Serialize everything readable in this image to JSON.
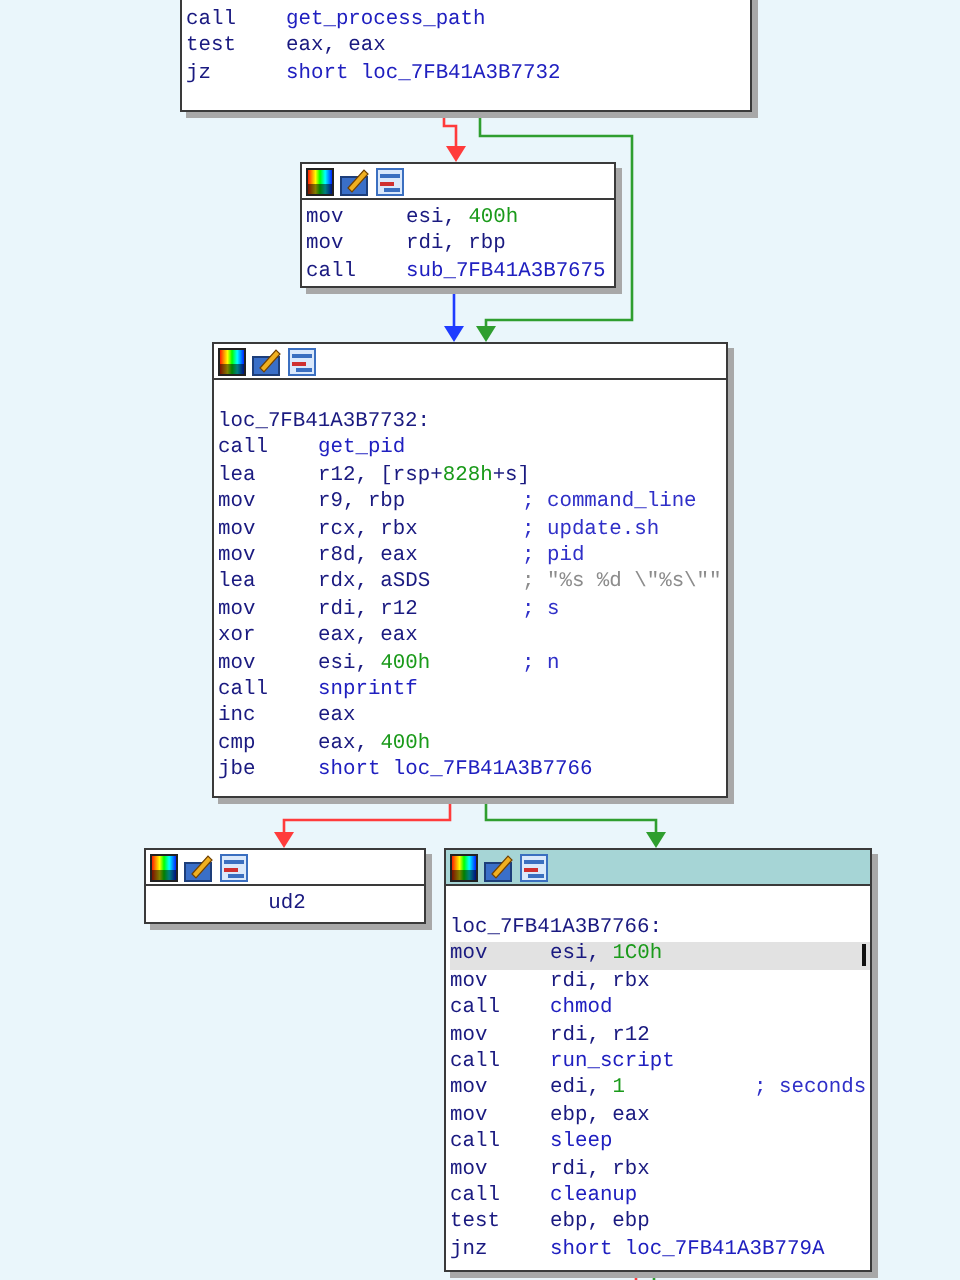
{
  "graph": {
    "nodes": [
      {
        "kind": "block",
        "lines": [
          {
            "kind": "insn",
            "selected": false,
            "mnemonic": "call",
            "operand": [
              {
                "text": "get_process_path",
                "kind": "name"
              }
            ]
          },
          {
            "kind": "insn",
            "selected": false,
            "mnemonic": "test",
            "operand": [
              {
                "text": "eax, eax",
                "kind": "reg"
              }
            ]
          },
          {
            "kind": "insn",
            "selected": false,
            "mnemonic": "jz",
            "operand": [
              {
                "text": "short loc_7FB41A3B7732",
                "kind": "name"
              }
            ]
          }
        ]
      },
      {
        "kind": "block",
        "active": false,
        "lines": [
          {
            "kind": "insn",
            "selected": false,
            "mnemonic": "mov",
            "operand": [
              {
                "text": "esi, ",
                "kind": "reg"
              },
              {
                "text": "400h",
                "kind": "num"
              }
            ]
          },
          {
            "kind": "insn",
            "selected": false,
            "mnemonic": "mov",
            "operand": [
              {
                "text": "rdi, rbp",
                "kind": "reg"
              }
            ]
          },
          {
            "kind": "insn",
            "selected": false,
            "mnemonic": "call",
            "operand": [
              {
                "text": "sub_7FB41A3B7675",
                "kind": "name"
              }
            ]
          }
        ]
      },
      {
        "kind": "block",
        "active": false,
        "lines": [
          {
            "kind": "label",
            "selected": false,
            "text": "loc_7FB41A3B7732:"
          },
          {
            "kind": "insn",
            "selected": false,
            "mnemonic": "call",
            "operand": [
              {
                "text": "get_pid",
                "kind": "name"
              }
            ]
          },
          {
            "kind": "insn",
            "selected": false,
            "mnemonic": "lea",
            "operand": [
              {
                "text": "r12, [rsp+",
                "kind": "reg"
              },
              {
                "text": "828h",
                "kind": "num"
              },
              {
                "text": "+s]",
                "kind": "reg"
              }
            ]
          },
          {
            "kind": "insn",
            "selected": false,
            "mnemonic": "mov",
            "operand": [
              {
                "text": "r9, rbp",
                "kind": "reg"
              }
            ],
            "comment": {
              "text": "; command_line",
              "kind": "comment"
            }
          },
          {
            "kind": "insn",
            "selected": false,
            "mnemonic": "mov",
            "operand": [
              {
                "text": "rcx, rbx",
                "kind": "reg"
              }
            ],
            "comment": {
              "text": "; update.sh",
              "kind": "comment"
            }
          },
          {
            "kind": "insn",
            "selected": false,
            "mnemonic": "mov",
            "operand": [
              {
                "text": "r8d, eax",
                "kind": "reg"
              }
            ],
            "comment": {
              "text": "; pid",
              "kind": "comment"
            }
          },
          {
            "kind": "insn",
            "selected": false,
            "mnemonic": "lea",
            "operand": [
              {
                "text": "rdx, aSDS",
                "kind": "reg"
              }
            ],
            "comment": {
              "text": "; \"%s %d \\\"%s\\\"\"",
              "kind": "string"
            }
          },
          {
            "kind": "insn",
            "selected": false,
            "mnemonic": "mov",
            "operand": [
              {
                "text": "rdi, r12",
                "kind": "reg"
              }
            ],
            "comment": {
              "text": "; s",
              "kind": "comment"
            }
          },
          {
            "kind": "insn",
            "selected": false,
            "mnemonic": "xor",
            "operand": [
              {
                "text": "eax, eax",
                "kind": "reg"
              }
            ]
          },
          {
            "kind": "insn",
            "selected": false,
            "mnemonic": "mov",
            "operand": [
              {
                "text": "esi, ",
                "kind": "reg"
              },
              {
                "text": "400h",
                "kind": "num"
              }
            ],
            "comment": {
              "text": "; n",
              "kind": "comment"
            }
          },
          {
            "kind": "insn",
            "selected": false,
            "mnemonic": "call",
            "operand": [
              {
                "text": "snprintf",
                "kind": "name"
              }
            ]
          },
          {
            "kind": "insn",
            "selected": false,
            "mnemonic": "inc",
            "operand": [
              {
                "text": "eax",
                "kind": "reg"
              }
            ]
          },
          {
            "kind": "insn",
            "selected": false,
            "mnemonic": "cmp",
            "operand": [
              {
                "text": "eax, ",
                "kind": "reg"
              },
              {
                "text": "400h",
                "kind": "num"
              }
            ]
          },
          {
            "kind": "insn",
            "selected": false,
            "mnemonic": "jbe",
            "operand": [
              {
                "text": "short loc_7FB41A3B7766",
                "kind": "name"
              }
            ]
          }
        ]
      },
      {
        "kind": "stub",
        "active": false,
        "lines": [
          {
            "kind": "insn",
            "selected": false,
            "mnemonic": "ud2"
          }
        ]
      },
      {
        "kind": "block",
        "active": true,
        "lines": [
          {
            "kind": "label",
            "selected": false,
            "text": "loc_7FB41A3B7766:"
          },
          {
            "kind": "insn",
            "selected": true,
            "mnemonic": "mov",
            "operand": [
              {
                "text": "esi, ",
                "kind": "reg"
              },
              {
                "text": "1C0h",
                "kind": "num"
              }
            ]
          },
          {
            "kind": "insn",
            "selected": false,
            "mnemonic": "mov",
            "operand": [
              {
                "text": "rdi, rbx",
                "kind": "reg"
              }
            ]
          },
          {
            "kind": "insn",
            "selected": false,
            "mnemonic": "call",
            "operand": [
              {
                "text": "chmod",
                "kind": "name"
              }
            ]
          },
          {
            "kind": "insn",
            "selected": false,
            "mnemonic": "mov",
            "operand": [
              {
                "text": "rdi, r12",
                "kind": "reg"
              }
            ]
          },
          {
            "kind": "insn",
            "selected": false,
            "mnemonic": "call",
            "operand": [
              {
                "text": "run_script",
                "kind": "name"
              }
            ]
          },
          {
            "kind": "insn",
            "selected": false,
            "mnemonic": "mov",
            "operand": [
              {
                "text": "edi, ",
                "kind": "reg"
              },
              {
                "text": "1",
                "kind": "num"
              }
            ],
            "comment": {
              "text": "; seconds",
              "kind": "comment"
            }
          },
          {
            "kind": "insn",
            "selected": false,
            "mnemonic": "mov",
            "operand": [
              {
                "text": "ebp, eax",
                "kind": "reg"
              }
            ]
          },
          {
            "kind": "insn",
            "selected": false,
            "mnemonic": "call",
            "operand": [
              {
                "text": "sleep",
                "kind": "name"
              }
            ]
          },
          {
            "kind": "insn",
            "selected": false,
            "mnemonic": "mov",
            "operand": [
              {
                "text": "rdi, rbx",
                "kind": "reg"
              }
            ]
          },
          {
            "kind": "insn",
            "selected": false,
            "mnemonic": "call",
            "operand": [
              {
                "text": "cleanup",
                "kind": "name"
              }
            ]
          },
          {
            "kind": "insn",
            "selected": false,
            "mnemonic": "test",
            "operand": [
              {
                "text": "ebp, ebp",
                "kind": "reg"
              }
            ]
          },
          {
            "kind": "insn",
            "selected": false,
            "mnemonic": "jnz",
            "operand": [
              {
                "text": "short loc_7FB41A3B779A",
                "kind": "name"
              }
            ]
          }
        ]
      }
    ],
    "edges": [
      {
        "kind": "false"
      },
      {
        "kind": "true"
      },
      {
        "kind": "jump"
      },
      {
        "kind": "false"
      },
      {
        "kind": "true"
      },
      {
        "kind": "false"
      },
      {
        "kind": "true"
      }
    ]
  }
}
